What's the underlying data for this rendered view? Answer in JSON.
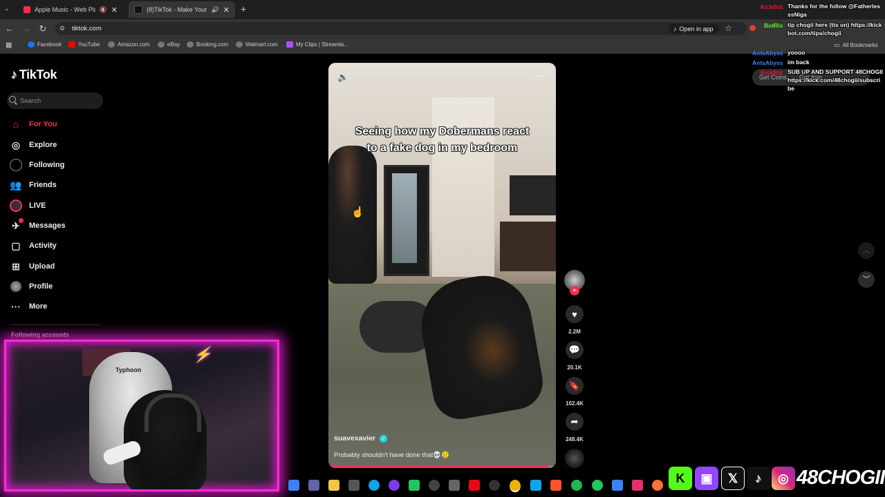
{
  "browser": {
    "tabs": [
      {
        "label": "Apple Music - Web Player",
        "favicon_color": "#fa2d48"
      },
      {
        "label": "(8)TikTok - Make Your Day",
        "favicon_color": "#111111"
      }
    ],
    "url": "tiktok.com",
    "open_in_app": "Open in app",
    "bookmarks": [
      {
        "label": "Facebook",
        "color": "#1877f2"
      },
      {
        "label": "YouTube",
        "color": "#ff0000"
      },
      {
        "label": "Amazon.com",
        "color": "#dddddd"
      },
      {
        "label": "eBay",
        "color": "#dddddd"
      },
      {
        "label": "Booking.com",
        "color": "#dddddd"
      },
      {
        "label": "Walmart.com",
        "color": "#dddddd"
      },
      {
        "label": "My Clips | Streamla...",
        "color": "#a855f7"
      }
    ],
    "all_bookmarks": "All Bookmarks"
  },
  "tiktok": {
    "logo_text": "TikTok",
    "search_placeholder": "Search",
    "nav": [
      {
        "label": "For You",
        "icon": "home-icon"
      },
      {
        "label": "Explore",
        "icon": "compass-icon"
      },
      {
        "label": "Following",
        "icon": "following-icon"
      },
      {
        "label": "Friends",
        "icon": "friends-icon"
      },
      {
        "label": "LIVE",
        "icon": "live-icon"
      },
      {
        "label": "Messages",
        "icon": "messages-icon"
      },
      {
        "label": "Activity",
        "icon": "activity-icon"
      },
      {
        "label": "Upload",
        "icon": "upload-icon"
      },
      {
        "label": "Profile",
        "icon": "profile-icon"
      },
      {
        "label": "More",
        "icon": "more-icon"
      }
    ],
    "following_accounts": "Following accounts",
    "accent_color": "#fe2c55"
  },
  "video": {
    "overlay_caption_line1": "Seeing how my Dobermans react",
    "overlay_caption_line2": "to a fake dog in my bedroom",
    "username": "suavexavier",
    "description": "Probably shouldn't have done that💀🥲",
    "progress": 0.97,
    "likes": "2.2M",
    "comments": "20.1K",
    "saves": "102.4K",
    "shares": "248.4K"
  },
  "webcam": {
    "chair_label": "Typhoon"
  },
  "chat": {
    "messages": [
      {
        "user": "KickBot",
        "user_color": "#e0173a",
        "text": "Thanks for the follow @FatherlesssNiga"
      },
      {
        "user": "BotRix",
        "user_color": "#53fc18",
        "text": "tip chogii here (tts on) https://kickbot.com/tips/chogii"
      },
      {
        "user": "AntsAbyss",
        "user_color": "#3b82f6",
        "text": "yoooo"
      },
      {
        "user": "AntsAbyss",
        "user_color": "#3b82f6",
        "text": "im back"
      },
      {
        "user": "KickBot",
        "user_color": "#e0173a",
        "text": "SUB UP AND SUPPORT 48CHOGII https://kick.com/48chogii/subscribe"
      }
    ],
    "get_coins": "Get Coins",
    "get_app": "Get App"
  },
  "socials": {
    "handle": "48CHOGII",
    "kick_color": "#53fc18",
    "twitch_color": "#9146ff",
    "x_color": "#111111",
    "tiktok_color": "#111111",
    "instagram_color": "#d62976"
  }
}
